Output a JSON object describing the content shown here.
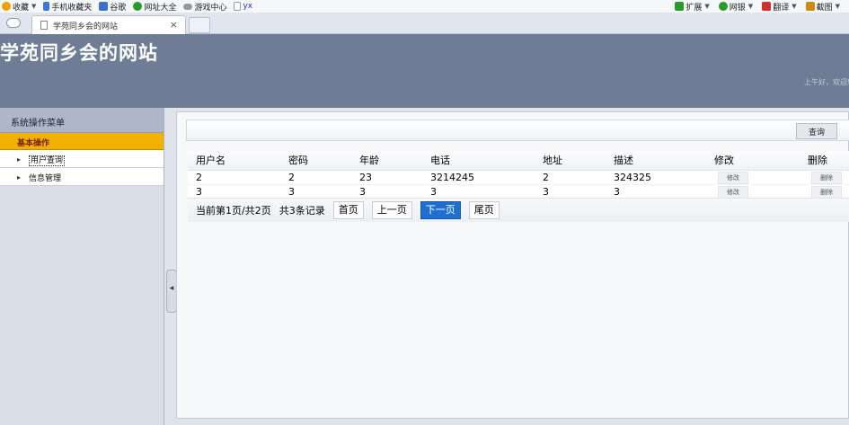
{
  "favorites_bar": {
    "left": [
      {
        "label": "收藏",
        "icon": "star-icon",
        "color": "#f0a000",
        "dropdown": true
      },
      {
        "label": "手机收藏夹",
        "icon": "phone-icon",
        "color": "#3a78d6"
      },
      {
        "label": "谷歌",
        "icon": "google-icon",
        "color": "#3b6fd0"
      },
      {
        "label": "网址大全",
        "icon": "globe-icon",
        "color": "#2a9a2a"
      },
      {
        "label": "游戏中心",
        "icon": "gamepad-icon",
        "color": "#888888"
      },
      {
        "label": "yx",
        "icon": "page-icon",
        "color": "#999999"
      }
    ],
    "right": [
      {
        "label": "扩展",
        "icon": "extension-icon",
        "color": "#2a9a2a"
      },
      {
        "label": "网银",
        "icon": "bank-icon",
        "color": "#2a9a2a"
      },
      {
        "label": "翻译",
        "icon": "translate-icon",
        "color": "#d03030"
      },
      {
        "label": "截图",
        "icon": "screenshot-icon",
        "color": "#d08a10"
      }
    ]
  },
  "tab": {
    "title": "学苑同乡会的网站",
    "close": "×"
  },
  "header": {
    "title": "学苑同乡会的网站",
    "greeting": "上午好，欢迎您"
  },
  "sidebar": {
    "title": "系统操作菜单",
    "group": "基本操作",
    "items": [
      {
        "label": "用户查询"
      },
      {
        "label": "信息管理"
      }
    ],
    "collapse_arrow": "◂"
  },
  "search": {
    "value": "",
    "placeholder": "",
    "button": "查询"
  },
  "table": {
    "columns": [
      "用户名",
      "密码",
      "年龄",
      "电话",
      "地址",
      "描述",
      "修改",
      "删除"
    ],
    "rows": [
      {
        "username": "2",
        "password": "2",
        "age": "23",
        "phone": "3214245",
        "address": "2",
        "desc": "324325",
        "edit": "修改",
        "delete": "删除"
      },
      {
        "username": "3",
        "password": "3",
        "age": "3",
        "phone": "3",
        "address": "3",
        "desc": "3",
        "edit": "修改",
        "delete": "删除"
      }
    ]
  },
  "pager": {
    "info": "当前第1页/共2页",
    "count": "共3条记录",
    "first": "首页",
    "prev": "上一页",
    "next": "下一页",
    "last": "尾页"
  },
  "colors": {
    "header_bg": "#6e7d95",
    "menu_group_bg": "#f2b100",
    "menu_group_text": "#7a1f00",
    "active_button": "#1f6fd0"
  }
}
